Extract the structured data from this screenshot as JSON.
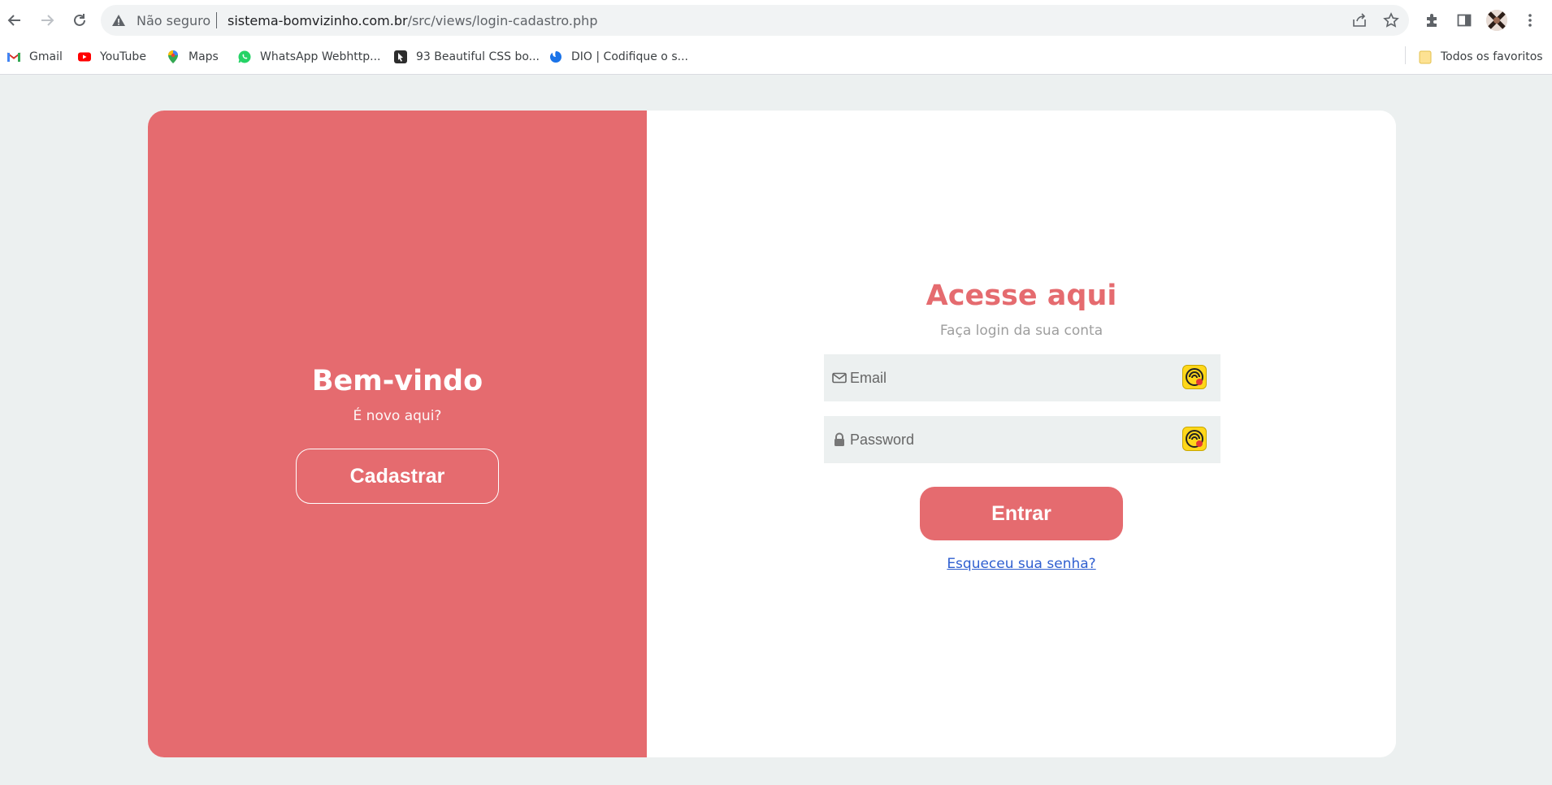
{
  "browser": {
    "security_label": "Não seguro",
    "url_domain": "sistema-bomvizinho.com.br",
    "url_path": "/src/views/login-cadastro.php"
  },
  "bookmarks": {
    "items": [
      {
        "label": "Gmail",
        "icon": "gmail-icon"
      },
      {
        "label": "YouTube",
        "icon": "youtube-icon"
      },
      {
        "label": "Maps",
        "icon": "maps-icon"
      },
      {
        "label": "WhatsApp Webhttp...",
        "icon": "whatsapp-icon"
      },
      {
        "label": "93 Beautiful CSS bo...",
        "icon": "bookmark-site-icon"
      },
      {
        "label": "DIO | Codifique o s...",
        "icon": "dio-icon"
      }
    ],
    "all_favorites": "Todos os favoritos"
  },
  "welcome": {
    "title": "Bem-vindo",
    "subtitle": "É novo aqui?",
    "register_button": "Cadastrar"
  },
  "login": {
    "title": "Acesse aqui",
    "subtitle": "Faça login da sua conta",
    "email_placeholder": "Email",
    "password_placeholder": "Password",
    "submit_button": "Entrar",
    "forgot_link": "Esqueceu sua senha?"
  },
  "colors": {
    "accent": "#e56b6f",
    "page_background": "#ecf0f0",
    "input_background": "#ecf0f0",
    "link": "#2f5fd0"
  }
}
